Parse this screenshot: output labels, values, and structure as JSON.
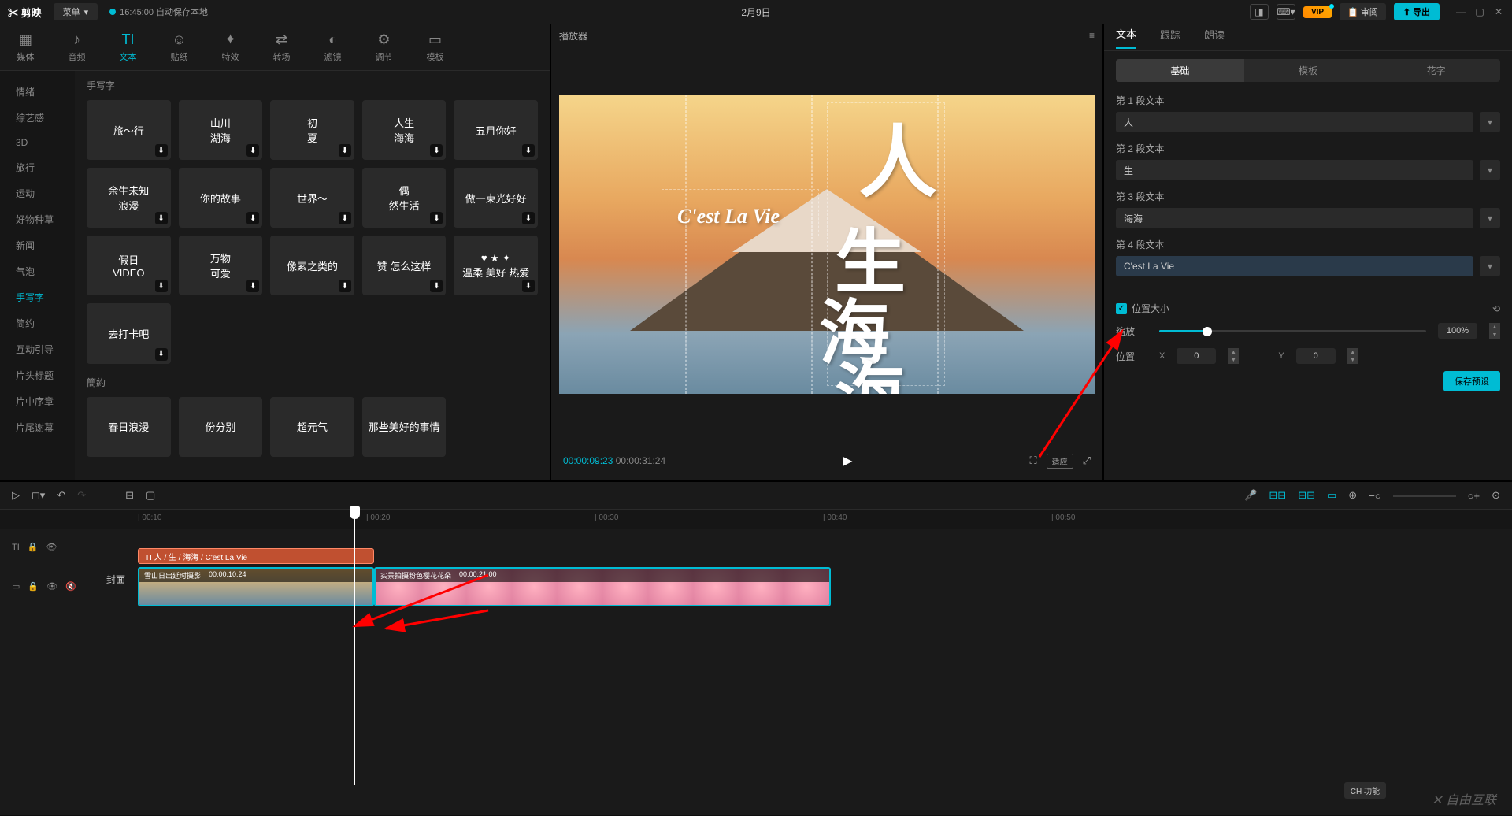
{
  "titlebar": {
    "logo": "✂ 剪映",
    "menu": "菜单",
    "autosave": "16:45:00 自动保存本地",
    "project_title": "2月9日",
    "review": "审阅",
    "export": "导出",
    "vip": "VIP"
  },
  "top_tabs": [
    {
      "icon": "▦",
      "label": "媒体"
    },
    {
      "icon": "♪",
      "label": "音频"
    },
    {
      "icon": "TI",
      "label": "文本"
    },
    {
      "icon": "☺",
      "label": "贴纸"
    },
    {
      "icon": "✦",
      "label": "特效"
    },
    {
      "icon": "⇄",
      "label": "转场"
    },
    {
      "icon": "◐",
      "label": "滤镜"
    },
    {
      "icon": "⚙",
      "label": "调节"
    },
    {
      "icon": "▭",
      "label": "模板"
    }
  ],
  "categories": [
    "情绪",
    "综艺感",
    "3D",
    "旅行",
    "运动",
    "好物种草",
    "新闻",
    "气泡",
    "手写字",
    "简约",
    "互动引导",
    "片头标题",
    "片中序章",
    "片尾谢幕"
  ],
  "active_category": "手写字",
  "section_label_1": "手写字",
  "section_label_2": "簡約",
  "assets": [
    "旅～行",
    "山川\n湖海",
    "初\n夏",
    "人生\n海海",
    "五月你好",
    "余生未知\n浪漫",
    "你的故事",
    "世界～",
    "偶\n然生活",
    "做一束光好好",
    "假日\nVIDEO",
    "万物\n可爱",
    "像素之类的",
    "赞 怎么这样",
    "♥ ★ ✦\n温柔 美好 热爱",
    "去打卡吧"
  ],
  "assets2": [
    "春日浪漫",
    "份分别",
    "超元气",
    "那些美好的事情"
  ],
  "player": {
    "header": "播放器",
    "current_time": "00:00:09:23",
    "total_time": "00:00:31:24",
    "ratio": "适应",
    "canvas_text_1": "人",
    "canvas_text_2": "生",
    "canvas_text_3": "海",
    "canvas_text_4": "海",
    "canvas_subtitle": "C'est La Vie"
  },
  "right_panel": {
    "tabs": [
      "文本",
      "跟踪",
      "朗读"
    ],
    "sub_tabs": [
      "基础",
      "模板",
      "花字"
    ],
    "segments": [
      {
        "label": "第 1 段文本",
        "value": "人"
      },
      {
        "label": "第 2 段文本",
        "value": "生"
      },
      {
        "label": "第 3 段文本",
        "value": "海海"
      },
      {
        "label": "第 4 段文本",
        "value": "C'est La Vie"
      }
    ],
    "position_size": "位置大小",
    "scale_label": "缩放",
    "scale_value": "100%",
    "position_label": "位置",
    "x_label": "X",
    "x_value": "0",
    "y_label": "Y",
    "y_value": "0",
    "save_preset": "保存预设"
  },
  "timeline": {
    "ruler": [
      "00:10",
      "00:20",
      "00:30",
      "00:40",
      "00:50"
    ],
    "text_clip": "TI 人 / 生 / 海海 / C'est La Vie",
    "clip1_name": "雪山日出延时摄影",
    "clip1_time": "00:00:10:24",
    "clip2_name": "实景拍摄粉色樱花花朵",
    "clip2_time": "00:00:21:00",
    "cover": "封面",
    "ch_indicator": "CH 功能"
  },
  "watermark": "✕ 自由互联"
}
